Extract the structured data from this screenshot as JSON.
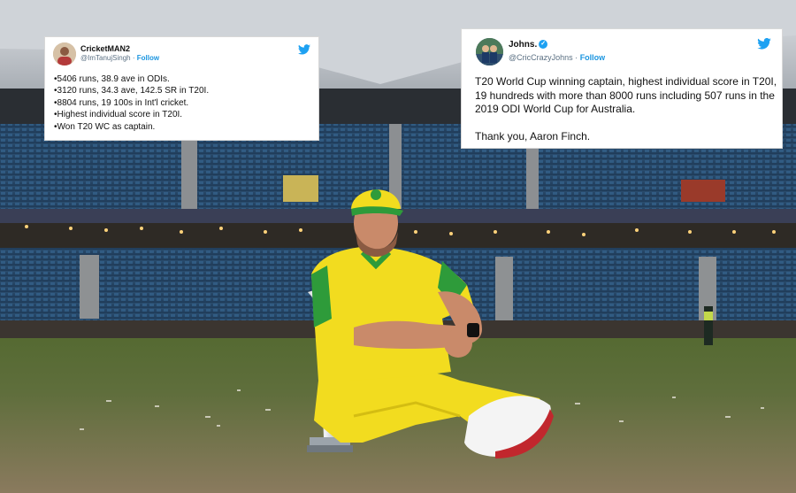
{
  "photo": {
    "subject": "cricketer-with-trophy",
    "colors": {
      "kit_yellow": "#f2dc1f",
      "kit_green": "#2e9b3a",
      "turf": "#5d6f3a",
      "seats": "#2f5f8f"
    }
  },
  "tweet_left": {
    "display_name": "CricketMAN2",
    "handle": "@ImTanujSingh",
    "follow_label": "Follow",
    "separator": "·",
    "icon": "twitter-bird-icon",
    "lines": [
      "•5406 runs, 38.9 ave in ODIs.",
      "•3120 runs, 34.3 ave, 142.5 SR in T20I.",
      "•8804 runs, 19 100s in Int'l cricket.",
      "•Highest individual score in T20I.",
      "•Won T20 WC as captain."
    ]
  },
  "tweet_right": {
    "display_name": "Johns.",
    "verified_icon": "verified-badge-icon",
    "handle": "@CricCrazyJohns",
    "follow_label": "Follow",
    "separator": "·",
    "icon": "twitter-bird-icon",
    "paragraph_1": "T20 World Cup winning captain, highest individual score in T20I, 19 hundreds with more than 8000 runs including 507 runs in the 2019 ODI World Cup for Australia.",
    "paragraph_2": "Thank you, Aaron Finch."
  },
  "colors": {
    "twitter_blue": "#1da1f2",
    "link_blue": "#1b95e0",
    "handle_grey": "#5b7083"
  }
}
